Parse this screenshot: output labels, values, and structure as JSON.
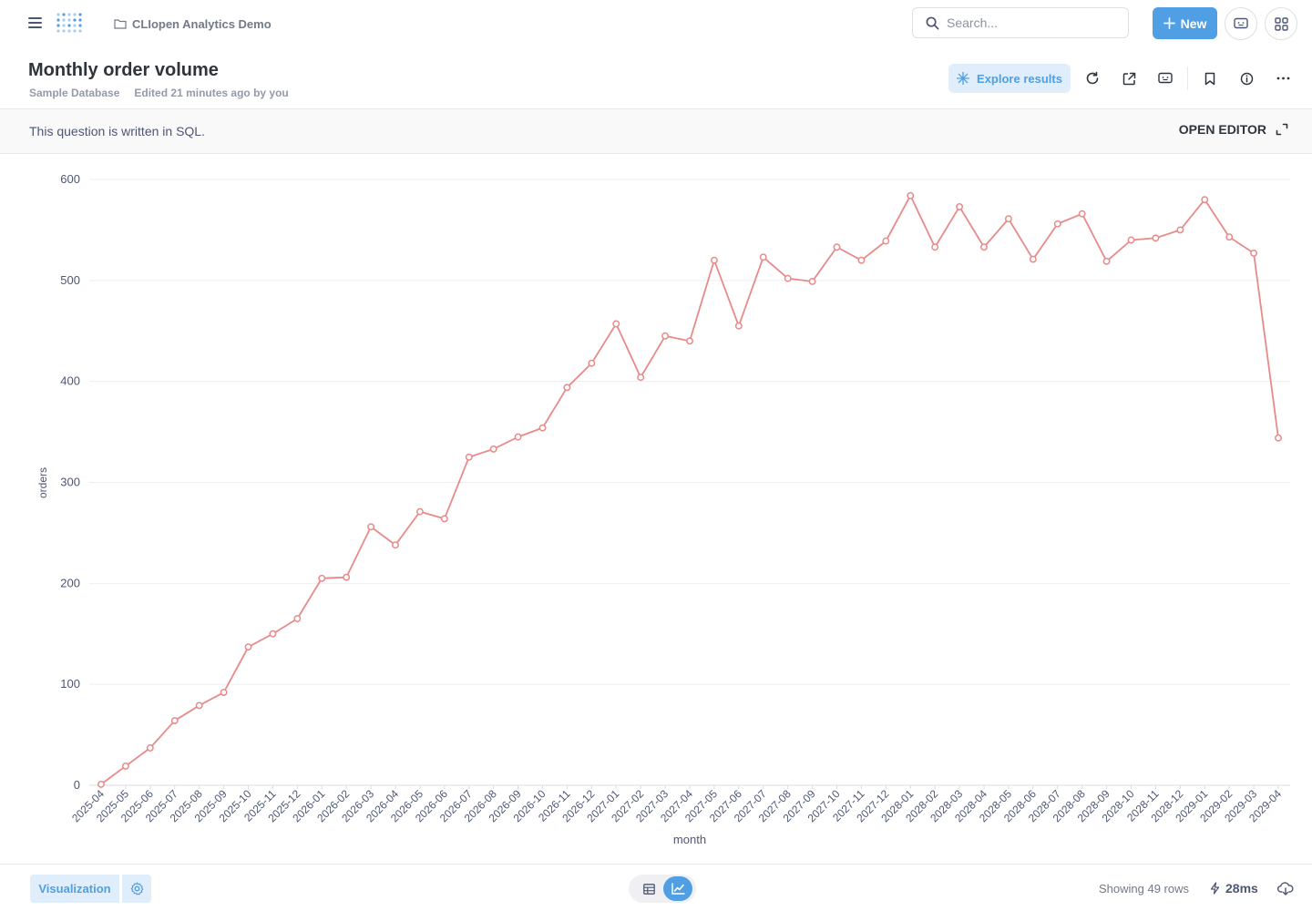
{
  "nav": {
    "collection": "CLIopen Analytics Demo",
    "search_placeholder": "Search...",
    "new_label": "New"
  },
  "question": {
    "title": "Monthly order volume",
    "database": "Sample Database",
    "edited": "Edited 21 minutes ago by you",
    "explore_label": "Explore results"
  },
  "banner": {
    "text": "This question is written in SQL.",
    "open_editor": "OPEN EDITOR"
  },
  "footer": {
    "visualization_label": "Visualization",
    "rows_text": "Showing 49 rows",
    "timing": "28ms"
  },
  "colors": {
    "brand": "#509ee3",
    "series": "#e88a8a",
    "grid": "#eceef1",
    "text": "#4c5773"
  },
  "icons": [
    "menu-icon",
    "logo-icon",
    "folder-icon",
    "search-icon",
    "plus-icon",
    "smart-screen-icon",
    "apps-grid-icon",
    "sparkle-icon",
    "refresh-icon",
    "share-icon",
    "bookmark-icon",
    "info-icon",
    "more-icon",
    "expand-icon",
    "gear-icon",
    "table-icon",
    "line-chart-icon",
    "bolt-icon",
    "download-icon"
  ],
  "chart_data": {
    "type": "line",
    "xlabel": "month",
    "ylabel": "orders",
    "ylim": [
      0,
      600
    ],
    "yticks": [
      0,
      100,
      200,
      300,
      400,
      500,
      600
    ],
    "grid": true,
    "x": [
      "2025-04",
      "2025-05",
      "2025-06",
      "2025-07",
      "2025-08",
      "2025-09",
      "2025-10",
      "2025-11",
      "2025-12",
      "2026-01",
      "2026-02",
      "2026-03",
      "2026-04",
      "2026-05",
      "2026-06",
      "2026-07",
      "2026-08",
      "2026-09",
      "2026-10",
      "2026-11",
      "2026-12",
      "2027-01",
      "2027-02",
      "2027-03",
      "2027-04",
      "2027-05",
      "2027-06",
      "2027-07",
      "2027-08",
      "2027-09",
      "2027-10",
      "2027-11",
      "2027-12",
      "2028-01",
      "2028-02",
      "2028-03",
      "2028-04",
      "2028-05",
      "2028-06",
      "2028-07",
      "2028-08",
      "2028-09",
      "2028-10",
      "2028-11",
      "2028-12",
      "2029-01",
      "2029-02",
      "2029-03",
      "2029-04"
    ],
    "series": [
      {
        "values": [
          1,
          19,
          37,
          64,
          79,
          92,
          137,
          150,
          165,
          205,
          206,
          256,
          238,
          271,
          264,
          325,
          333,
          345,
          354,
          394,
          418,
          457,
          404,
          445,
          440,
          520,
          455,
          523,
          502,
          499,
          533,
          520,
          539,
          584,
          533,
          573,
          533,
          561,
          521,
          556,
          566,
          519,
          540,
          542,
          550,
          580,
          543,
          527,
          344
        ]
      }
    ]
  }
}
